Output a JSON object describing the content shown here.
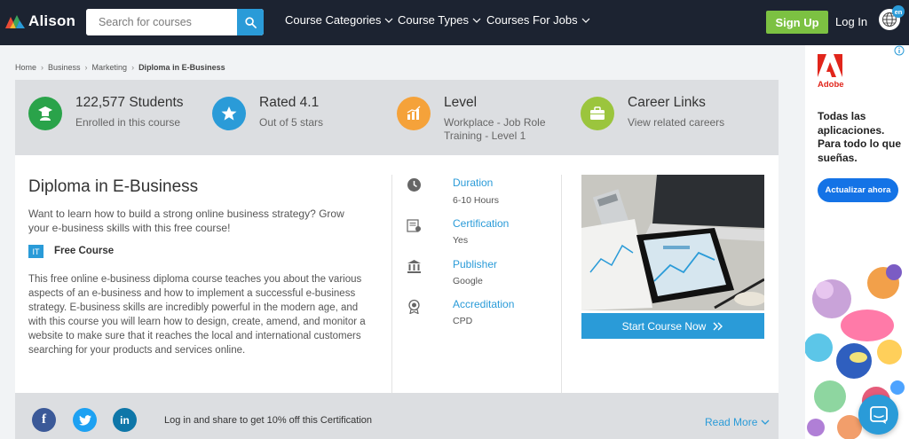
{
  "nav": {
    "logo_text": "Alison",
    "search_placeholder": "Search for courses",
    "menus": [
      "Course Categories",
      "Course Types",
      "Courses For Jobs"
    ],
    "signup": "Sign Up",
    "login": "Log In",
    "lang": "en"
  },
  "breadcrumb": [
    "Home",
    "Business",
    "Marketing",
    "Diploma in E-Business"
  ],
  "stats": [
    {
      "title": "122,577 Students",
      "sub": "Enrolled in this course",
      "icon": "student-icon",
      "color": "#2aa34a"
    },
    {
      "title": "Rated 4.1",
      "sub": "Out of 5 stars",
      "icon": "star-icon",
      "color": "#2a9bd8"
    },
    {
      "title": "Level",
      "sub": "Workplace - Job Role Training - Level 1",
      "sub_line1": "Workplace - Job Role",
      "sub_line2": "Training - Level 1",
      "icon": "chart-icon",
      "color": "#f5a23a"
    },
    {
      "title": "Career Links",
      "sub": "View related careers",
      "icon": "briefcase-icon",
      "color": "#9bc53d"
    }
  ],
  "course": {
    "title": "Diploma in E-Business",
    "lead": "Want to learn how to build a strong online business strategy? Grow your e-business skills with this free course!",
    "badge": "IT",
    "free_label": "Free Course",
    "description": "This free online e-business diploma course teaches you about the various aspects of an e-business and how to implement a successful e-business strategy. E-business skills are incredibly powerful in the modern age, and with this course you will learn how to design, create, amend, and monitor a website to make sure that it reaches the local and international customers searching for your products and services online.",
    "details": [
      {
        "label": "Duration",
        "value": "6-10 Hours",
        "icon": "clock-icon"
      },
      {
        "label": "Certification",
        "value": "Yes",
        "icon": "certificate-icon"
      },
      {
        "label": "Publisher",
        "value": "Google",
        "icon": "institution-icon"
      },
      {
        "label": "Accreditation",
        "value": "CPD",
        "icon": "award-icon"
      }
    ],
    "start_button": "Start Course Now"
  },
  "share": {
    "text": "Log in and share to get 10% off this Certification",
    "networks": [
      "f",
      "t",
      "in"
    ],
    "read_more": "Read More"
  },
  "ad": {
    "brand": "Adobe",
    "copy": "Todas las aplicaciones. Para todo lo que sueñas.",
    "button": "Actualizar ahora"
  },
  "colors": {
    "nav_bg": "#1c2331",
    "accent": "#2a9bd8",
    "signup": "#7cc142",
    "stats_bg": "#dcdee1"
  }
}
